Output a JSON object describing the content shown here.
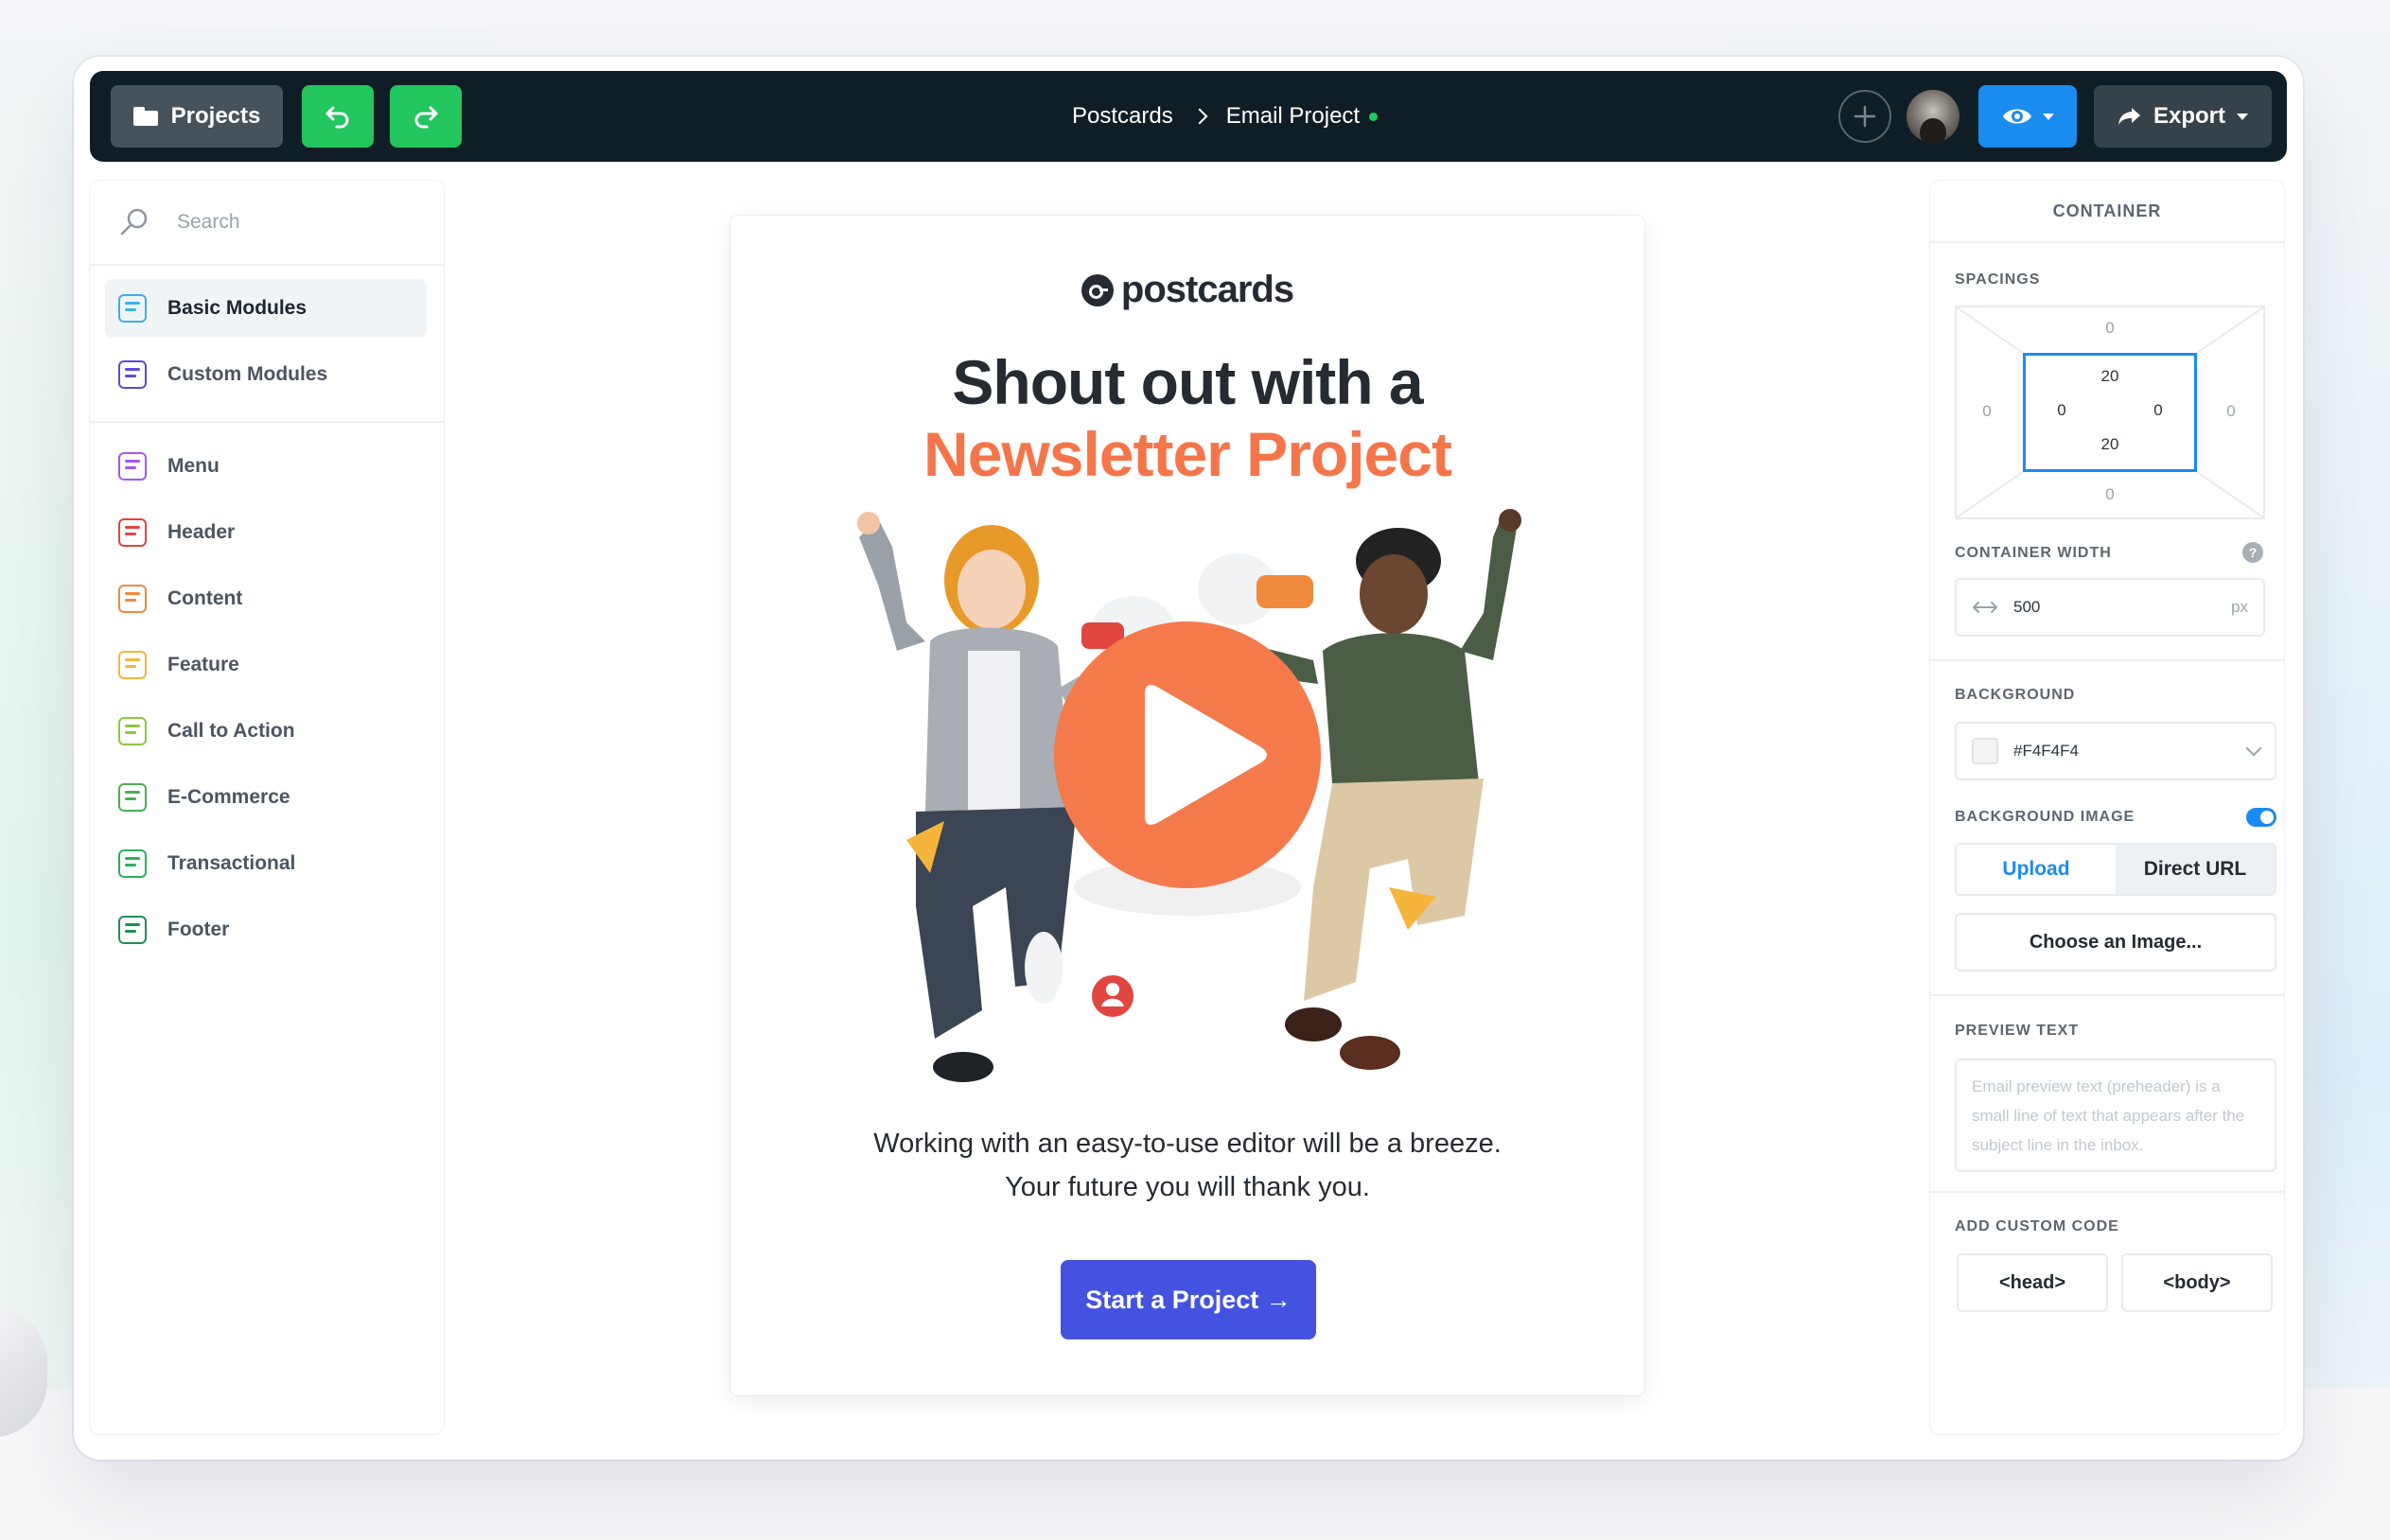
{
  "topbar": {
    "projects_label": "Projects",
    "breadcrumb": [
      "Postcards",
      "Email Project"
    ],
    "export_label": "Export",
    "status_color": "#22c55e"
  },
  "sidebar": {
    "search_placeholder": "Search",
    "primary": [
      {
        "label": "Basic Modules",
        "icon": "basic-modules-icon",
        "color": "#38b2e8",
        "active": true
      },
      {
        "label": "Custom Modules",
        "icon": "custom-modules-icon",
        "color": "#5b4bd6",
        "active": false
      }
    ],
    "modules": [
      {
        "label": "Menu",
        "icon": "menu-icon",
        "color": "#a855f7"
      },
      {
        "label": "Header",
        "icon": "header-icon",
        "color": "#e0453f"
      },
      {
        "label": "Content",
        "icon": "content-icon",
        "color": "#f08a3c"
      },
      {
        "label": "Feature",
        "icon": "feature-icon",
        "color": "#f5b53d"
      },
      {
        "label": "Call to Action",
        "icon": "call-to-action-icon",
        "color": "#8cc63f"
      },
      {
        "label": "E-Commerce",
        "icon": "e-commerce-icon",
        "color": "#4caf50"
      },
      {
        "label": "Transactional",
        "icon": "transactional-icon",
        "color": "#2eae5f"
      },
      {
        "label": "Footer",
        "icon": "footer-icon",
        "color": "#1f8f55"
      }
    ]
  },
  "email": {
    "brand": "postcards",
    "headline_1": "Shout out with a",
    "headline_2": "Newsletter Project",
    "body": "Working with an easy-to-use editor will be a breeze. Your future you will thank you.",
    "cta_label": "Start a Project →",
    "accent_color": "#f5754a",
    "cta_color": "#4352e0"
  },
  "panel": {
    "title": "CONTAINER",
    "spacings_label": "SPACINGS",
    "spacing": {
      "margin_top": "0",
      "margin_right": "0",
      "margin_bottom": "0",
      "margin_left": "0",
      "padding_top": "20",
      "padding_right": "0",
      "padding_bottom": "20",
      "padding_left": "0"
    },
    "width_label": "CONTAINER WIDTH",
    "width_value": "500",
    "width_unit": "px",
    "background_label": "BACKGROUND",
    "background_value": "#F4F4F4",
    "background_image_label": "BACKGROUND IMAGE",
    "background_image_enabled": true,
    "upload_tab": "Upload",
    "url_tab": "Direct URL",
    "choose_image": "Choose an Image...",
    "preview_text_label": "PREVIEW TEXT",
    "preview_text_placeholder": "Email preview text (preheader) is a small line of text that appears after the subject line in the inbox.",
    "custom_code_label": "ADD CUSTOM CODE",
    "head_label": "<head>",
    "body_label": "<body>",
    "help_glyph": "?"
  }
}
